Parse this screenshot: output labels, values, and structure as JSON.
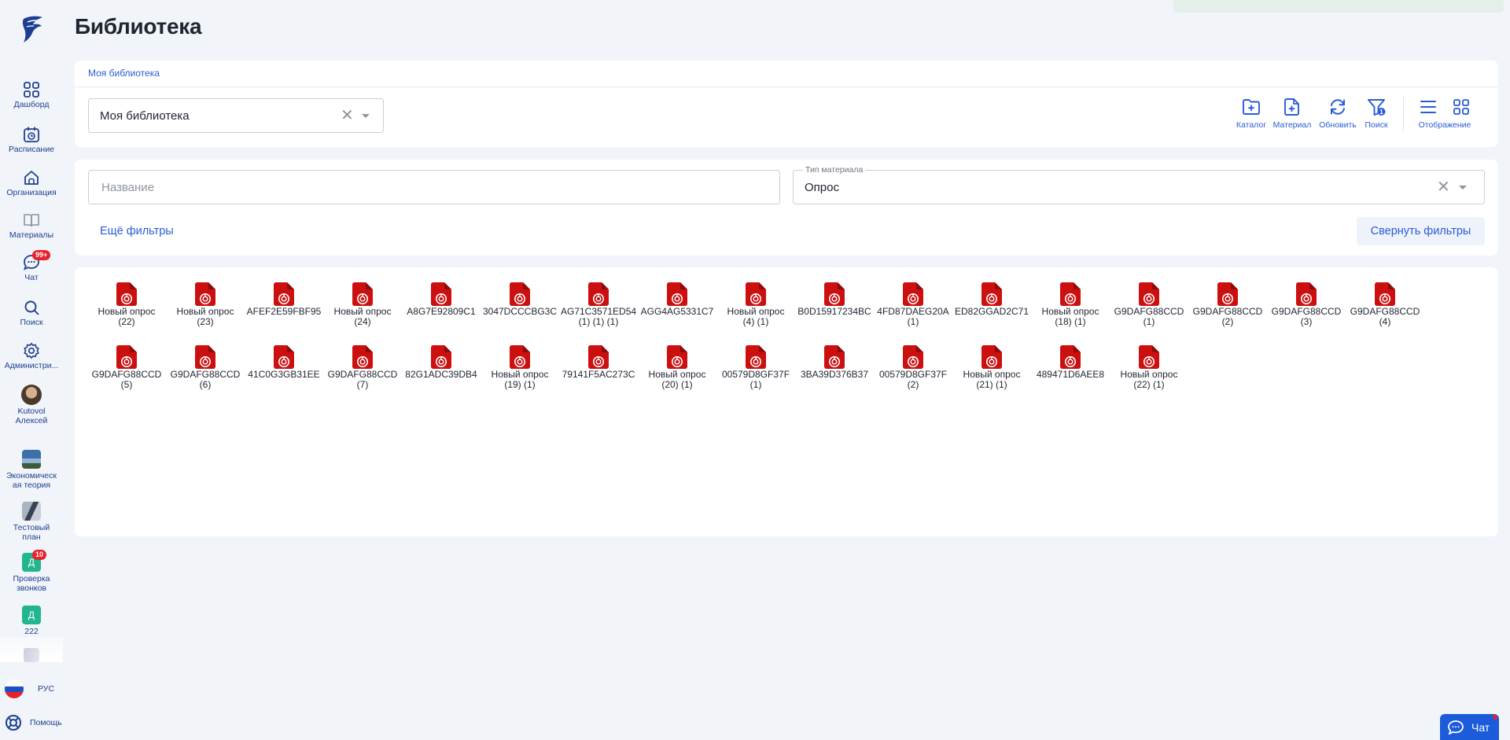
{
  "page": {
    "title": "Библиотека"
  },
  "sidebar": {
    "dashboard": "Дашборд",
    "schedule": "Расписание",
    "organization": "Организация",
    "materials": "Материалы",
    "chat": "Чат",
    "chat_badge": "99+",
    "search": "Поиск",
    "admin": "Администри...",
    "user_name": "Kutovol Алексей",
    "courses": [
      {
        "label": "Экономическ ая теория"
      },
      {
        "label": "Тестовый план"
      },
      {
        "label": "Проверка звонков",
        "badge": "10",
        "letter": "Д"
      },
      {
        "label": "222",
        "letter": "Д"
      }
    ],
    "language": "РУС",
    "help": "Помощь"
  },
  "toolbar": {
    "breadcrumb": "Моя библиотека",
    "library_select": "Моя библиотека",
    "catalog": "Каталог",
    "material": "Материал",
    "refresh": "Обновить",
    "search": "Поиск",
    "search_badge": "1",
    "display": "Отображение"
  },
  "filters": {
    "name_placeholder": "Название",
    "type_label": "Тип материала",
    "type_value": "Опрос",
    "more": "Ещё фильтры",
    "collapse": "Свернуть фильтры"
  },
  "files": [
    [
      "Новый опрос",
      "(22)"
    ],
    [
      "Новый опрос",
      "(23)"
    ],
    [
      "AFEF2E59FBF95",
      ""
    ],
    [
      "Новый опрос",
      "(24)"
    ],
    [
      "A8G7E92809C1",
      ""
    ],
    [
      "3047DCCCBG3C",
      ""
    ],
    [
      "AG71C3571ED54",
      "(1) (1) (1)"
    ],
    [
      "AGG4AG5331C7",
      ""
    ],
    [
      "Новый опрос",
      "(4) (1)"
    ],
    [
      "B0D15917234BC",
      ""
    ],
    [
      "4FD87DAEG20A",
      "(1)"
    ],
    [
      "ED82GGAD2C71",
      ""
    ],
    [
      "Новый опрос",
      "(18) (1)"
    ],
    [
      "G9DAFG88CCD",
      "(1)"
    ],
    [
      "G9DAFG88CCD",
      "(2)"
    ],
    [
      "G9DAFG88CCD",
      "(3)"
    ],
    [
      "G9DAFG88CCD",
      "(4)"
    ],
    [
      "G9DAFG88CCD",
      "(5)"
    ],
    [
      "G9DAFG88CCD",
      "(6)"
    ],
    [
      "41C0G3GB31EE",
      ""
    ],
    [
      "G9DAFG88CCD",
      "(7)"
    ],
    [
      "82G1ADC39DB4",
      ""
    ],
    [
      "Новый опрос",
      "(19) (1)"
    ],
    [
      "79141F5AC273C",
      ""
    ],
    [
      "Новый опрос",
      "(20) (1)"
    ],
    [
      "00579D8GF37F",
      "(1)"
    ],
    [
      "3BA39D376B37",
      ""
    ],
    [
      "00579D8GF37F",
      "(2)"
    ],
    [
      "Новый опрос",
      "(21) (1)"
    ],
    [
      "489471D6AEE8",
      ""
    ],
    [
      "Новый опрос",
      "(22) (1)"
    ]
  ],
  "chat_button": "Чат",
  "colors": {
    "accent": "#2a5bd7",
    "file_red": "#cc1010",
    "badge": "#e8222b",
    "nav": "#1d3f91"
  }
}
